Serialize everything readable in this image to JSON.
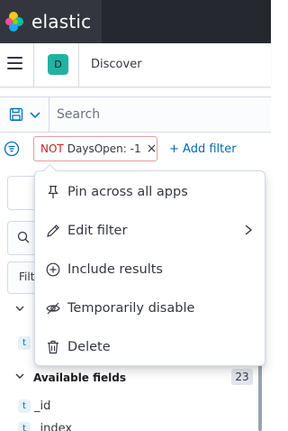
{
  "brand": {
    "name": "elastic"
  },
  "header": {
    "space_initial": "D",
    "breadcrumb": "Discover"
  },
  "query": {
    "placeholder": "Search"
  },
  "filter": {
    "negation": "NOT",
    "label": "DaysOpen: -1",
    "add_label": "+ Add filter"
  },
  "menu": {
    "items": [
      {
        "label": "Pin across all apps",
        "icon": "pin-icon"
      },
      {
        "label": "Edit filter",
        "icon": "pencil-icon"
      },
      {
        "label": "Include results",
        "icon": "plus-circle-icon"
      },
      {
        "label": "Temporarily disable",
        "icon": "eye-closed-icon"
      },
      {
        "label": "Delete",
        "icon": "trash-icon"
      }
    ]
  },
  "sidebar": {
    "filter_partial": "Filt",
    "available_label": "Available fields",
    "available_count": "23",
    "fields": [
      {
        "type": "t",
        "name": "_id"
      },
      {
        "type": "t",
        "name": "_index"
      }
    ]
  }
}
